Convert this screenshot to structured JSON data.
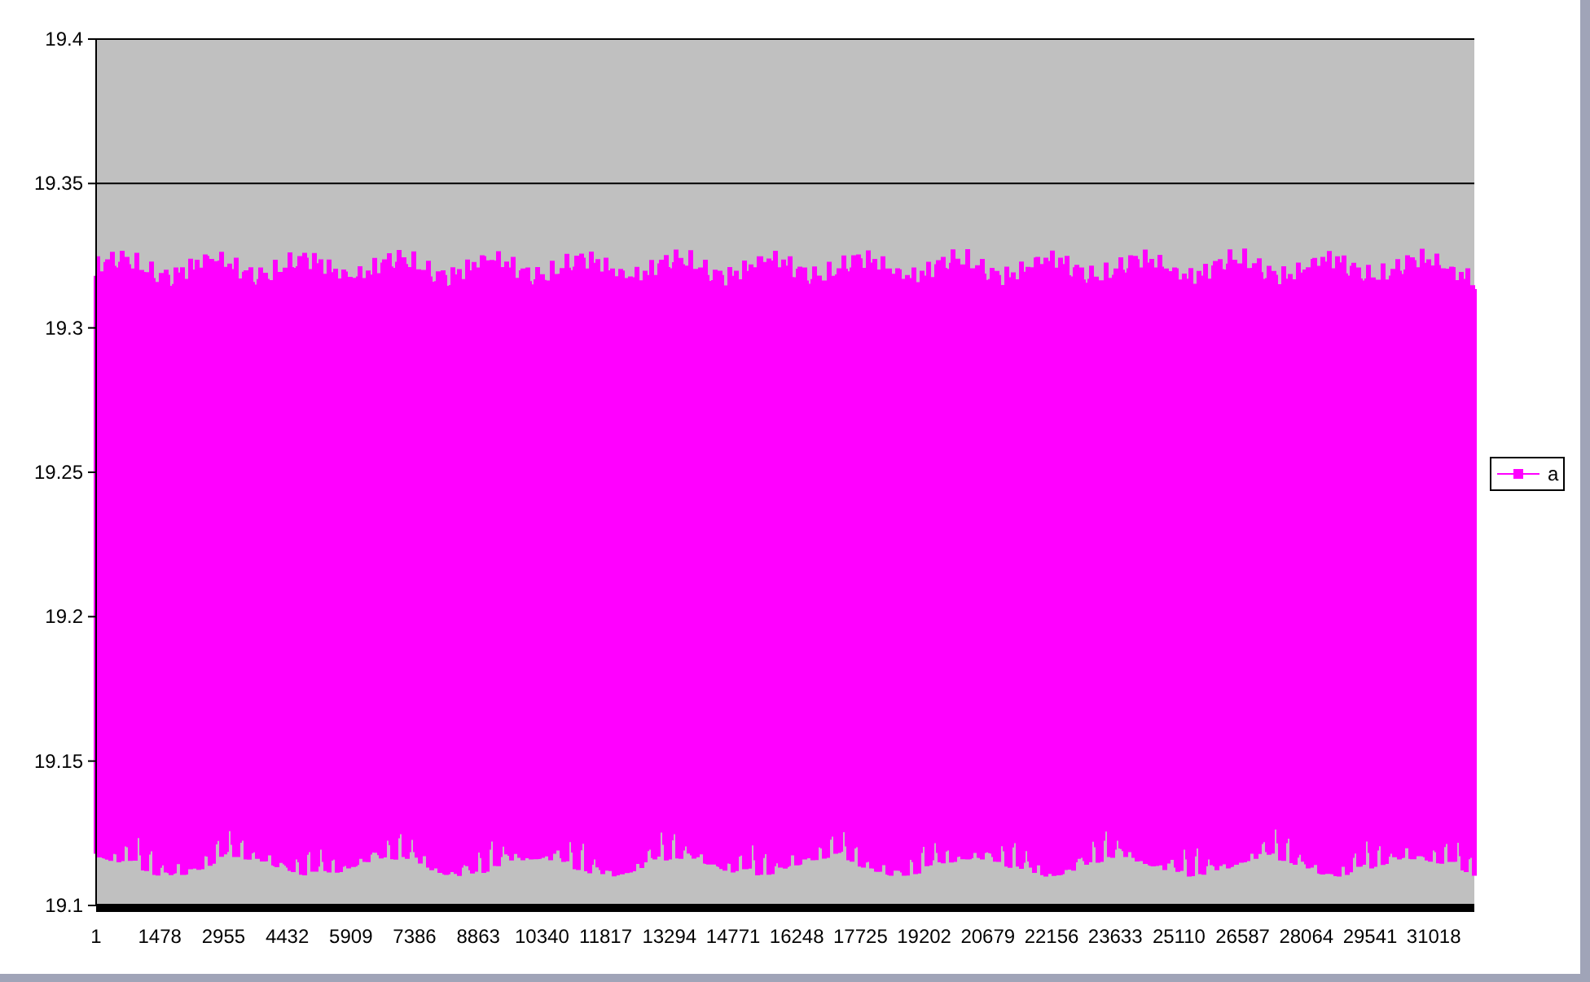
{
  "chart": {
    "kind": "noise-band",
    "y_axis_labels": [
      "19.4",
      "19.35",
      "19.3",
      "19.25",
      "19.2",
      "19.15",
      "19.1"
    ],
    "x_axis_labels": [
      "1",
      "1478",
      "2955",
      "4432",
      "5909",
      "7386",
      "8863",
      "10340",
      "11817",
      "13294",
      "14771",
      "16248",
      "17725",
      "19202",
      "20679",
      "22156",
      "23633",
      "25110",
      "26587",
      "28064",
      "29541",
      "31018"
    ],
    "legend": [
      {
        "label": "a",
        "color": "#ff00ff"
      }
    ]
  }
}
